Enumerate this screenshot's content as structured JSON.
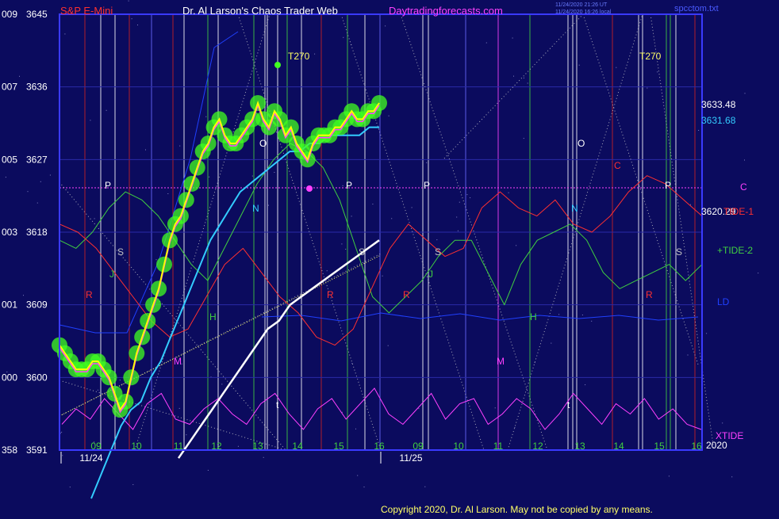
{
  "header": {
    "symbol": "S&P E-Mini",
    "author": "Dr. Al Larson's Chaos Trader Web",
    "site": "Daytradingforecasts.com",
    "stamp1": "11/24/2020 21:26 UT",
    "stamp2": "11/24/2020 16:26 local",
    "file": "spcctom.txt"
  },
  "footer": {
    "copyright": "Copyright 2020, Dr. Al Larson. May not be copied by any means."
  },
  "colors": {
    "background": "#0b0b5e",
    "frame": "#3a3aff",
    "price": "#ffff00",
    "price_mean": "#33ccff",
    "trend": "#ffffff",
    "tide1": "#ff3030",
    "tide2": "#40d040",
    "ld": "#2040ff",
    "xtide": "#ff40ff",
    "blob": "#40ff20",
    "text": "#ffffff",
    "copyright": "#ffff66"
  },
  "chart_data": {
    "type": "line",
    "ylim": [
      3591,
      3645
    ],
    "y_ticks": [
      {
        "left": "009",
        "right": "3645",
        "value": 3645
      },
      {
        "left": "007",
        "right": "3636",
        "value": 3636
      },
      {
        "left": "005",
        "right": "3627",
        "value": 3627
      },
      {
        "left": "003",
        "right": "3618",
        "value": 3618
      },
      {
        "left": "001",
        "right": "3609",
        "value": 3609
      },
      {
        "left": "000",
        "right": "3600",
        "value": 3600
      },
      {
        "left": "358",
        "right": "3591",
        "value": 3591
      }
    ],
    "x_ticks": [
      "09",
      "10",
      "11",
      "12",
      "13",
      "14",
      "15",
      "16",
      "09",
      "10",
      "11",
      "12",
      "13",
      "14",
      "15",
      "16"
    ],
    "dates": [
      "11/24",
      "11/25"
    ],
    "series": [
      {
        "name": "price",
        "values": [
          3604,
          3603,
          3602,
          3601,
          3601,
          3601,
          3602,
          3602,
          3601,
          3600,
          3598,
          3596,
          3597,
          3600,
          3603,
          3605,
          3607,
          3609,
          3611,
          3614,
          3617,
          3619,
          3620,
          3622,
          3624,
          3626,
          3628,
          3629,
          3631,
          3632,
          3630,
          3629,
          3629,
          3630,
          3631,
          3632,
          3634,
          3632,
          3631,
          3633,
          3632,
          3630,
          3631,
          3629,
          3628,
          3627,
          3629,
          3630,
          3630,
          3630,
          3631,
          3631,
          3632,
          3633,
          3632,
          3632,
          3633,
          3633,
          3634
        ]
      },
      {
        "name": "mean",
        "values": [
          3585,
          3588,
          3591,
          3594,
          3596,
          3597,
          3600,
          3602,
          3605,
          3608,
          3611,
          3614,
          3617,
          3619,
          3621,
          3623,
          3624,
          3625,
          3626,
          3627,
          3628,
          3628,
          3629,
          3629,
          3630,
          3630,
          3630,
          3630,
          3631,
          3631
        ]
      },
      {
        "name": "trend",
        "values": [
          3590,
          3592,
          3594,
          3596,
          3598,
          3600,
          3602,
          3604,
          3606,
          3607,
          3609,
          3610,
          3611,
          3612,
          3613,
          3614,
          3615,
          3616,
          3617
        ]
      },
      {
        "name": "TIDE-1",
        "values": [
          3619,
          3618,
          3616,
          3613,
          3610,
          3607,
          3605,
          3606,
          3610,
          3614,
          3616,
          3613,
          3610,
          3608,
          3605,
          3604,
          3606,
          3611,
          3616,
          3619,
          3617,
          3615,
          3616,
          3621,
          3623,
          3621,
          3620,
          3622,
          3619,
          3618,
          3620,
          3623,
          3625,
          3624,
          3622,
          3620
        ]
      },
      {
        "name": "+TIDE-2",
        "values": [
          3617,
          3616,
          3618,
          3621,
          3623,
          3622,
          3620,
          3617,
          3614,
          3612,
          3616,
          3620,
          3624,
          3627,
          3629,
          3628,
          3626,
          3622,
          3616,
          3610,
          3608,
          3610,
          3612,
          3615,
          3617,
          3617,
          3613,
          3609,
          3614,
          3617,
          3618,
          3619,
          3617,
          3613,
          3611,
          3612,
          3613,
          3614,
          3612,
          3614
        ]
      },
      {
        "name": "XTIDE",
        "values": [
          0.3,
          0.6,
          0.4,
          0.8,
          0.5,
          0.2,
          0.7,
          0.9,
          0.4,
          0.3,
          0.6,
          0.8,
          0.5,
          0.3,
          0.7,
          0.9,
          0.5,
          0.2,
          0.6,
          0.8,
          0.4,
          0.7,
          1.0,
          0.5,
          0.3,
          0.6,
          0.9,
          0.4,
          0.7,
          0.8,
          0.3,
          0.5,
          0.8,
          0.6,
          0.2,
          0.5,
          0.9,
          0.6,
          0.3,
          0.7,
          0.5,
          0.8,
          0.4,
          0.6,
          0.3,
          0.2
        ]
      }
    ],
    "right_labels": [
      "3633.48",
      "3631.68",
      "3620.29",
      "C",
      "TIDE-1",
      "+TIDE-2",
      "LD",
      "XTIDE",
      "2020"
    ],
    "marker_labels": [
      "T270",
      "T270",
      "P",
      "P",
      "P",
      "P",
      "S",
      "S",
      "S",
      "S",
      "N",
      "N",
      "R",
      "R",
      "R",
      "R",
      "M",
      "M",
      "H",
      "H",
      "O",
      "O",
      "C",
      "J",
      "J",
      "t",
      "t"
    ]
  }
}
